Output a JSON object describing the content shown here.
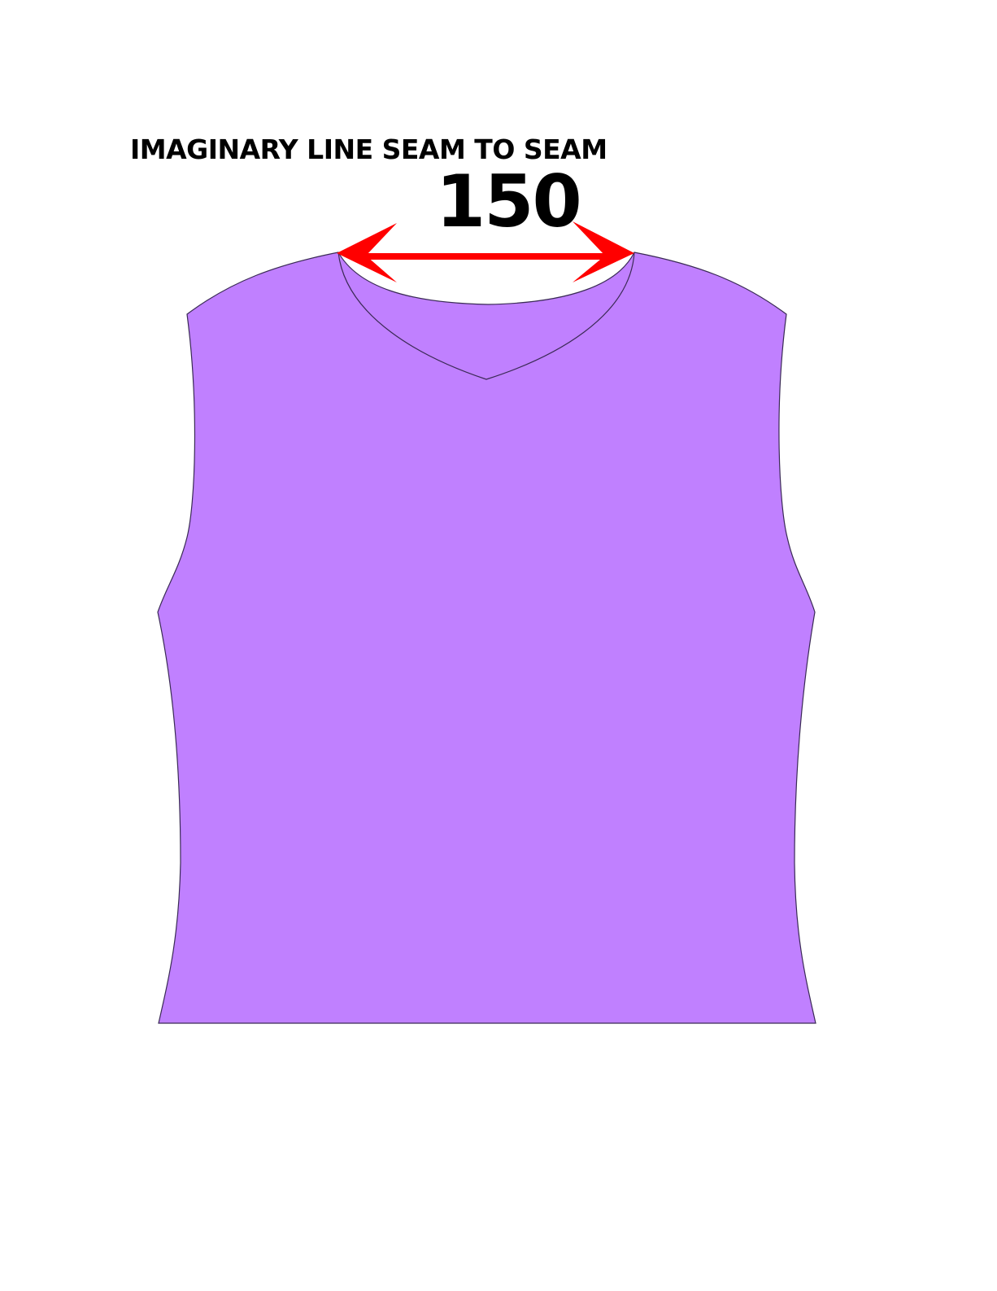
{
  "annotation": {
    "caption": "IMAGINARY LINE SEAM TO SEAM",
    "measurement": "150"
  },
  "garment": {
    "type": "sleeveless top",
    "fill_color": "#C080FF",
    "outline_color": "#3A2A55"
  },
  "arrow": {
    "color": "#FF0000",
    "style": "double-headed"
  }
}
